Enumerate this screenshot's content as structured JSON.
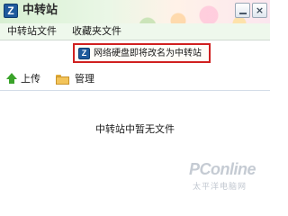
{
  "window": {
    "title": "中转站",
    "logo_glyph": "Z",
    "close_glyph": "×"
  },
  "menu": {
    "items": [
      "中转站文件",
      "收藏夹文件"
    ]
  },
  "notice": {
    "icon_glyph": "Z",
    "text": "网络硬盘即将改名为中转站",
    "border_color": "#d02020"
  },
  "toolbar": {
    "upload_label": "上传",
    "manage_label": "管理"
  },
  "main": {
    "empty_text": "中转站中暂无文件"
  },
  "watermark": {
    "brand": "PConline",
    "tagline": "太平洋电脑网"
  }
}
